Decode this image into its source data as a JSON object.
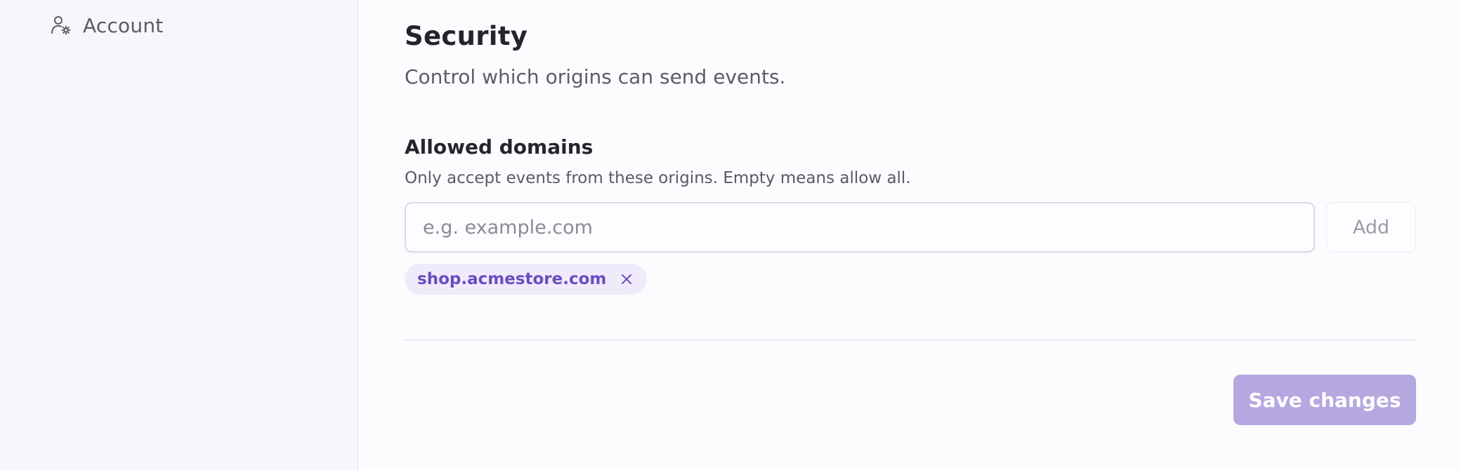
{
  "sidebar": {
    "items": [
      {
        "label": "Account",
        "icon": "user-gear-icon"
      }
    ]
  },
  "main": {
    "title": "Security",
    "subtitle": "Control which origins can send events.",
    "allowed_domains": {
      "title": "Allowed domains",
      "description": "Only accept events from these origins. Empty means allow all.",
      "input_value": "",
      "input_placeholder": "e.g. example.com",
      "add_label": "Add",
      "domains": [
        {
          "label": "shop.acmestore.com",
          "remove_icon": "close-icon"
        }
      ]
    },
    "save_label": "Save changes"
  },
  "colors": {
    "accent": "#6b4dc0",
    "chip_background": "#efebfb",
    "save_button_disabled": "#b5a7e0",
    "sidebar_background": "#f8f6fd"
  }
}
